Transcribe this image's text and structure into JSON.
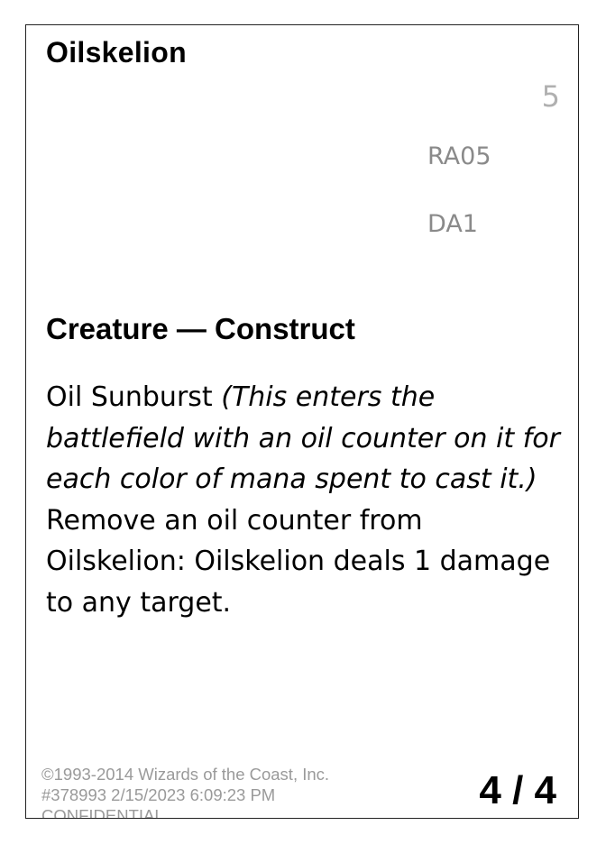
{
  "card": {
    "name": "Oilskelion",
    "mana_cost": "5",
    "codes": [
      "RA05",
      "DA1"
    ],
    "type_line": "Creature — Construct",
    "rules": {
      "ability_name": "Oil Sunburst",
      "reminder": "(This enters the battlefield with an oil counter on it for each color of mana spent to cast it.)",
      "ability_2": "Remove an oil counter from Oilskelion: Oilskelion deals 1 damage to any target."
    },
    "footer": {
      "copyright": "©1993-2014 Wizards of the Coast, Inc.",
      "stamp": "#378993 2/15/2023 6:09:23 PM",
      "confidential": "CONFIDENTIAL"
    },
    "power_toughness": "4 / 4"
  }
}
